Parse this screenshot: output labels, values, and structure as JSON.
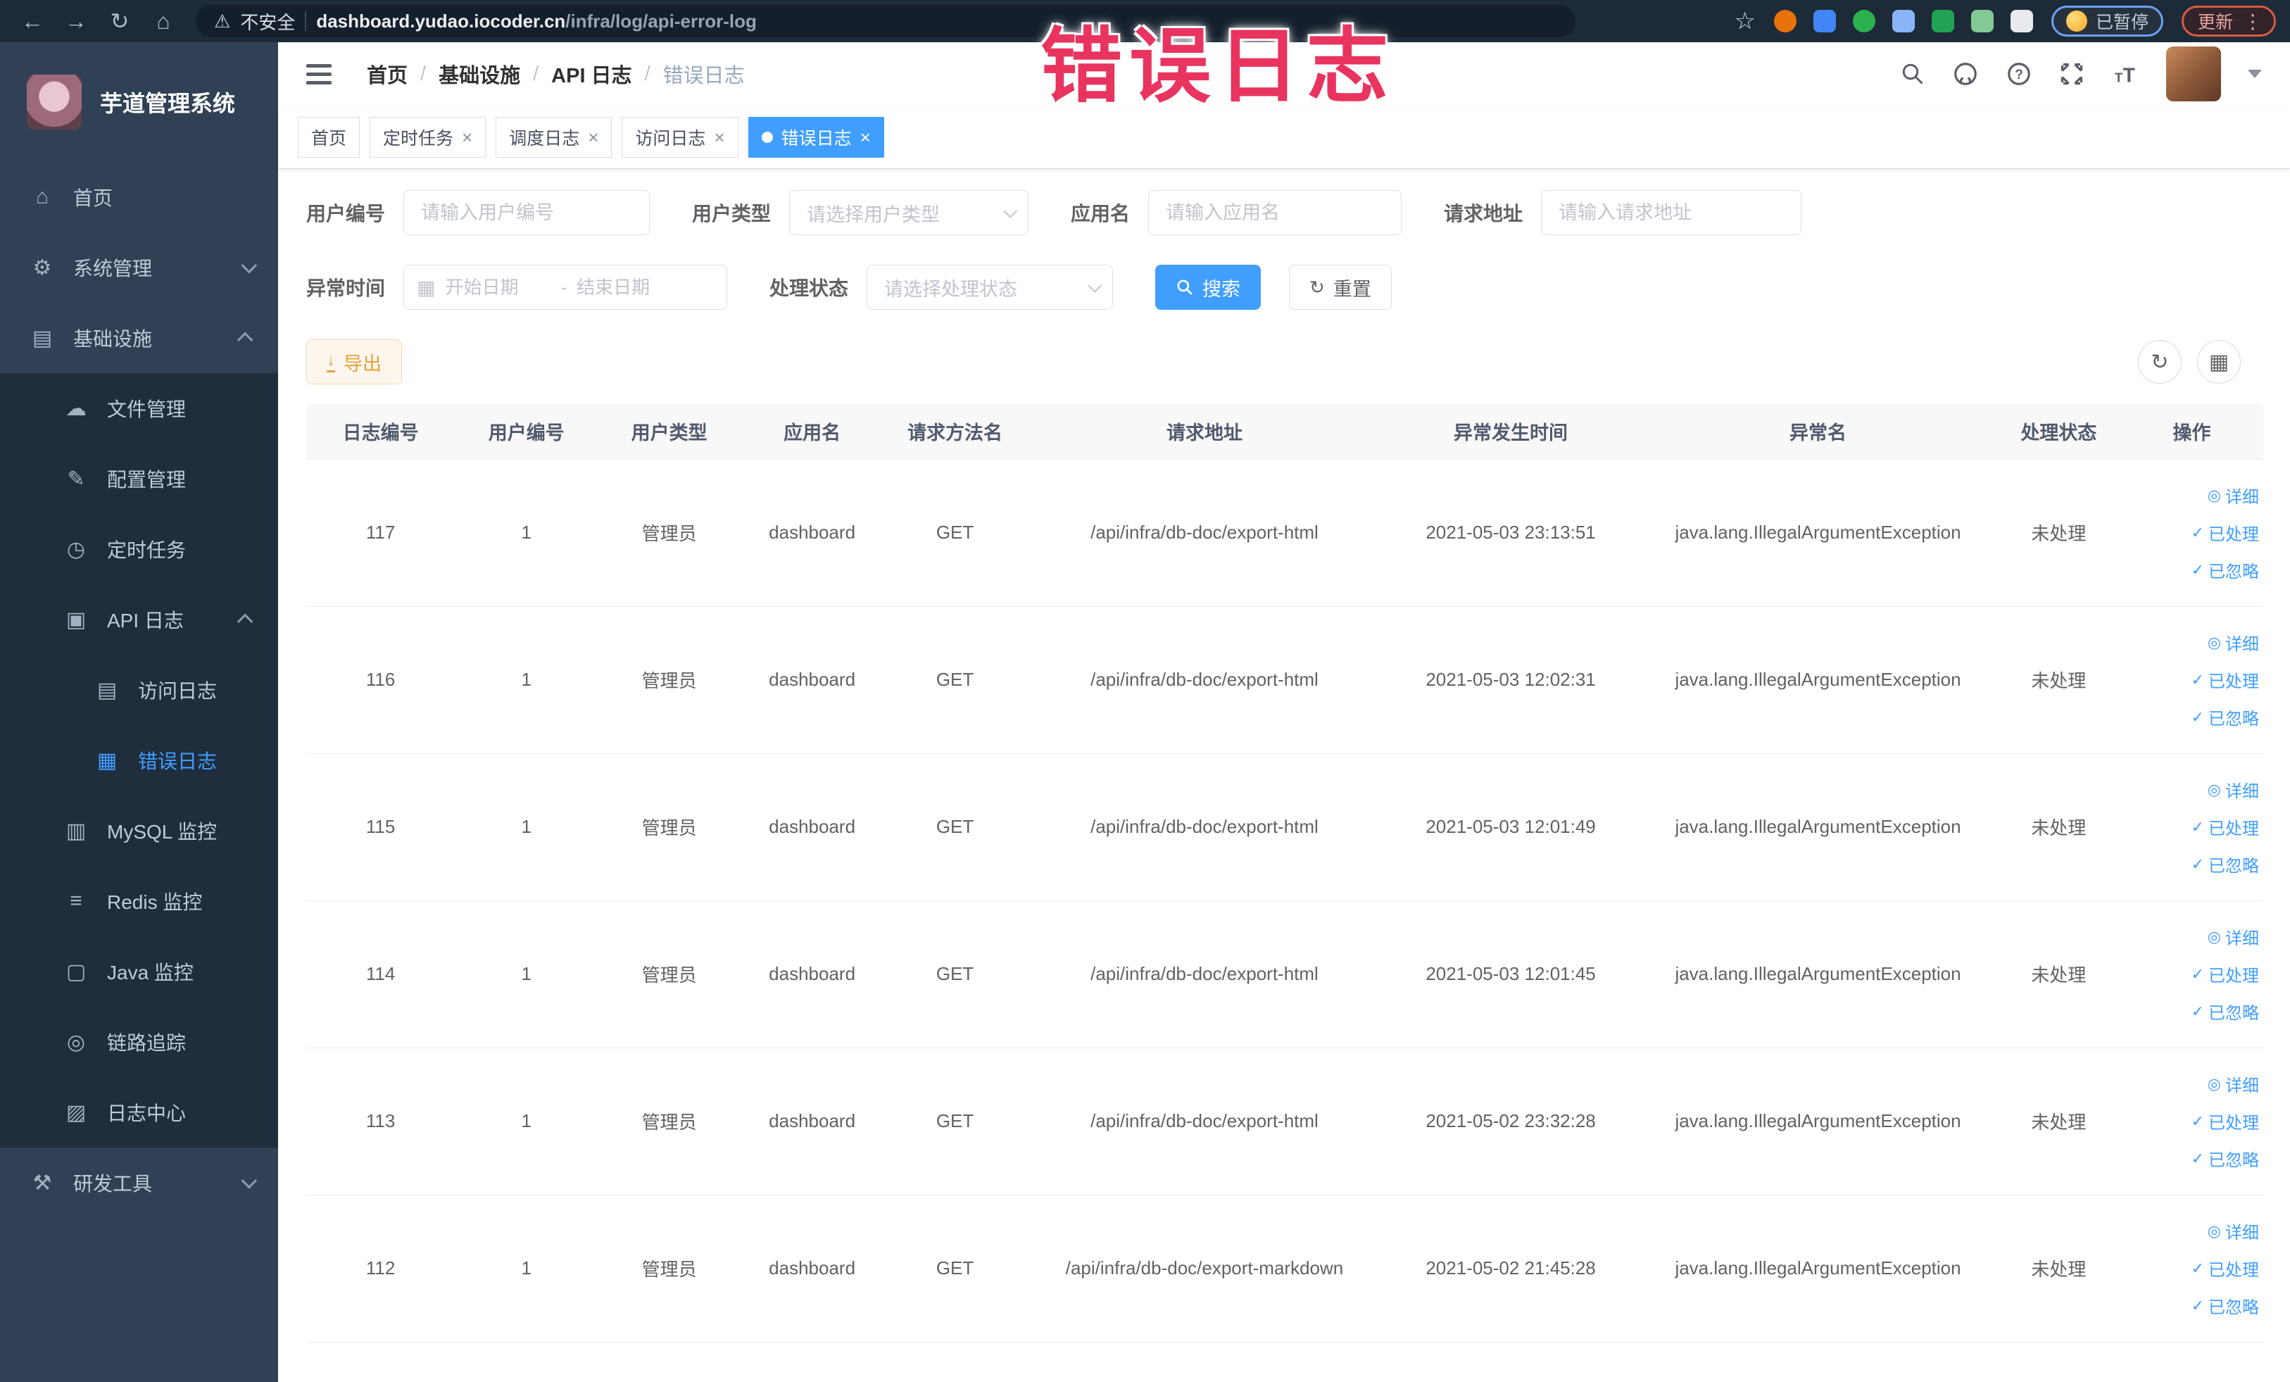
{
  "browser": {
    "security_label": "不安全",
    "url_domain": "dashboard.yudao.iocoder.cn",
    "url_path": "/infra/log/api-error-log",
    "paused_chip": "已暂停",
    "update_button": "更新",
    "extension_icons": [
      {
        "name": "ext-orange-circle-icon",
        "color": "#e8710a"
      },
      {
        "name": "ext-blue-shield-icon",
        "color": "#4285f4"
      },
      {
        "name": "ext-green-circle-icon",
        "color": "#2bb24c"
      },
      {
        "name": "ext-grid-icon",
        "color": "#8ab4f8"
      },
      {
        "name": "ext-onoff-icon",
        "color": "#21a355"
      },
      {
        "name": "ext-leaf-icon",
        "color": "#81c995"
      },
      {
        "name": "extensions-puzzle-icon",
        "color": "#e8eaed"
      }
    ]
  },
  "overlay": {
    "text": "错误日志",
    "color": "#e8345e"
  },
  "sidebar": {
    "title": "芋道管理系统",
    "menu": [
      {
        "label": "首页",
        "icon": "home",
        "level": 1
      },
      {
        "label": "系统管理",
        "icon": "system",
        "level": 1,
        "chevron": "down"
      },
      {
        "label": "基础设施",
        "icon": "infra",
        "level": 1,
        "chevron": "up"
      },
      {
        "label": "文件管理",
        "icon": "file",
        "level": 2
      },
      {
        "label": "配置管理",
        "icon": "config",
        "level": 2
      },
      {
        "label": "定时任务",
        "icon": "job",
        "level": 2
      },
      {
        "label": "API 日志",
        "icon": "apilog",
        "level": 2,
        "chevron": "up"
      },
      {
        "label": "访问日志",
        "icon": "access",
        "level": 3
      },
      {
        "label": "错误日志",
        "icon": "error",
        "level": 3,
        "active": true
      },
      {
        "label": "MySQL 监控",
        "icon": "mysql",
        "level": 2
      },
      {
        "label": "Redis 监控",
        "icon": "redis",
        "level": 2
      },
      {
        "label": "Java 监控",
        "icon": "java",
        "level": 2
      },
      {
        "label": "链路追踪",
        "icon": "trace",
        "level": 2
      },
      {
        "label": "日志中心",
        "icon": "logcenter",
        "level": 2
      },
      {
        "label": "研发工具",
        "icon": "tools",
        "level": 1,
        "chevron": "down"
      }
    ]
  },
  "header": {
    "breadcrumb": [
      "首页",
      "基础设施",
      "API 日志",
      "错误日志"
    ]
  },
  "tabs": [
    {
      "label": "首页",
      "closable": false,
      "active": false
    },
    {
      "label": "定时任务",
      "closable": true,
      "active": false
    },
    {
      "label": "调度日志",
      "closable": true,
      "active": false
    },
    {
      "label": "访问日志",
      "closable": true,
      "active": false
    },
    {
      "label": "错误日志",
      "closable": true,
      "active": true
    }
  ],
  "filters": {
    "user_id": {
      "label": "用户编号",
      "placeholder": "请输入用户编号"
    },
    "user_type": {
      "label": "用户类型",
      "placeholder": "请选择用户类型"
    },
    "app_name": {
      "label": "应用名",
      "placeholder": "请输入应用名"
    },
    "req_url": {
      "label": "请求地址",
      "placeholder": "请输入请求地址"
    },
    "time": {
      "label": "异常时间",
      "start_placeholder": "开始日期",
      "end_placeholder": "结束日期",
      "separator": "-"
    },
    "status": {
      "label": "处理状态",
      "placeholder": "请选择处理状态"
    },
    "search_label": "搜索",
    "reset_label": "重置"
  },
  "toolbar": {
    "export_label": "导出"
  },
  "table": {
    "columns": [
      "日志编号",
      "用户编号",
      "用户类型",
      "应用名",
      "请求方法名",
      "请求地址",
      "异常发生时间",
      "异常名",
      "处理状态",
      "操作"
    ],
    "row_actions": [
      {
        "label": "详细",
        "icon": "view"
      },
      {
        "label": "已处理",
        "icon": "check"
      },
      {
        "label": "已忽略",
        "icon": "check"
      }
    ],
    "rows": [
      {
        "id": "117",
        "user_id": "1",
        "user_type": "管理员",
        "app": "dashboard",
        "method": "GET",
        "url": "/api/infra/db-doc/export-html",
        "time": "2021-05-03 23:13:51",
        "exception": "java.lang.IllegalArgumentException",
        "status": "未处理"
      },
      {
        "id": "116",
        "user_id": "1",
        "user_type": "管理员",
        "app": "dashboard",
        "method": "GET",
        "url": "/api/infra/db-doc/export-html",
        "time": "2021-05-03 12:02:31",
        "exception": "java.lang.IllegalArgumentException",
        "status": "未处理"
      },
      {
        "id": "115",
        "user_id": "1",
        "user_type": "管理员",
        "app": "dashboard",
        "method": "GET",
        "url": "/api/infra/db-doc/export-html",
        "time": "2021-05-03 12:01:49",
        "exception": "java.lang.IllegalArgumentException",
        "status": "未处理"
      },
      {
        "id": "114",
        "user_id": "1",
        "user_type": "管理员",
        "app": "dashboard",
        "method": "GET",
        "url": "/api/infra/db-doc/export-html",
        "time": "2021-05-03 12:01:45",
        "exception": "java.lang.IllegalArgumentException",
        "status": "未处理"
      },
      {
        "id": "113",
        "user_id": "1",
        "user_type": "管理员",
        "app": "dashboard",
        "method": "GET",
        "url": "/api/infra/db-doc/export-html",
        "time": "2021-05-02 23:32:28",
        "exception": "java.lang.IllegalArgumentException",
        "status": "未处理"
      },
      {
        "id": "112",
        "user_id": "1",
        "user_type": "管理员",
        "app": "dashboard",
        "method": "GET",
        "url": "/api/infra/db-doc/export-markdown",
        "time": "2021-05-02 21:45:28",
        "exception": "java.lang.IllegalArgumentException",
        "status": "未处理"
      }
    ]
  },
  "colors": {
    "accent": "#409eff",
    "warning": "#e6a23c",
    "sidebar_bg": "#304156",
    "submenu_bg": "#1f2d3d"
  }
}
